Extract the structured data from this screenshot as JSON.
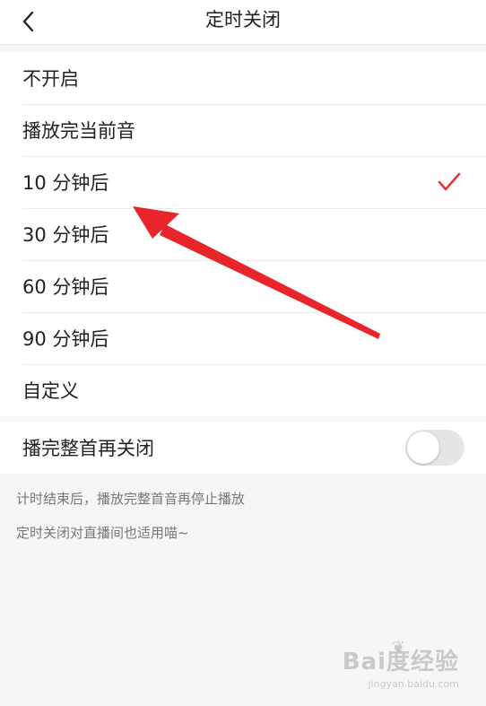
{
  "header": {
    "title": "定时关闭"
  },
  "options": [
    {
      "label": "不开启",
      "selected": false
    },
    {
      "label": "播放完当前音",
      "selected": false
    },
    {
      "label": "10 分钟后",
      "selected": true
    },
    {
      "label": "30 分钟后",
      "selected": false
    },
    {
      "label": "60 分钟后",
      "selected": false
    },
    {
      "label": "90 分钟后",
      "selected": false
    },
    {
      "label": "自定义",
      "selected": false
    }
  ],
  "toggle": {
    "label": "播完整首再关闭",
    "on": false
  },
  "notes": {
    "line1": "计时结束后，播放完整首音再停止播放",
    "line2": "定时关闭对直播间也适用喵~"
  },
  "watermark": {
    "brand": "Bai度经验",
    "sub": "jingyan.baidu.com"
  },
  "colors": {
    "accent": "#e53935",
    "annotation_arrow": "#e8252b",
    "background": "#f6f6f6"
  },
  "icons": {
    "back": "chevron-left-icon",
    "check": "checkmark-icon"
  }
}
